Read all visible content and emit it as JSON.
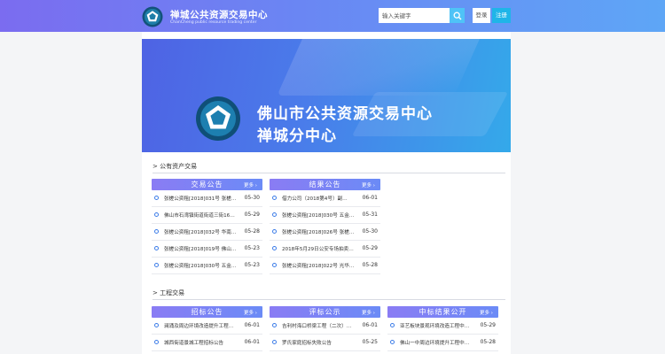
{
  "header": {
    "brand_cn": "禅城公共资源交易中心",
    "brand_en": "ChanCheng public resource trading center",
    "search_placeholder": "输入关键字",
    "login": "登录",
    "register": "注册"
  },
  "banner": {
    "line1": "佛山市公共资源交易中心",
    "line2": "禅城分中心"
  },
  "sections": [
    {
      "title": "> 公有资产交易",
      "panels": [
        {
          "title": "交易公告",
          "more": "更多 ›",
          "items": [
            {
              "text": "张槎公资租[2018]031号 张槎…",
              "date": "05-30"
            },
            {
              "text": "佛山市石湾镇街道街道三街16…",
              "date": "05-29"
            },
            {
              "text": "张槎公资租[2018]032号 华南…",
              "date": "05-28"
            },
            {
              "text": "张槎公资租[2018]019号 佛山…",
              "date": "05-23"
            },
            {
              "text": "张槎公资租[2018]030号 五金…",
              "date": "05-23"
            }
          ]
        },
        {
          "title": "结果公告",
          "more": "更多 ›",
          "items": [
            {
              "text": "借力公司（2018第4号）副…",
              "date": "06-01"
            },
            {
              "text": "张槎公资租[2018]030号 五金…",
              "date": "05-31"
            },
            {
              "text": "张槎公资租[2018]026号 张槎…",
              "date": "05-30"
            },
            {
              "text": "2018年5月29日公安专场拍卖…",
              "date": "05-29"
            },
            {
              "text": "张槎公资租[2018]022号 光华…",
              "date": "05-28"
            }
          ]
        }
      ]
    },
    {
      "title": "> 工程交易",
      "panels": [
        {
          "title": "招标公告",
          "more": "更多 ›",
          "items": [
            {
              "text": "澜涌及周边环境改造提升工程…",
              "date": "06-01"
            },
            {
              "text": "城西街道景城工程招标公告",
              "date": "06-01"
            }
          ]
        },
        {
          "title": "评标公示",
          "more": "更多 ›",
          "items": [
            {
              "text": "吉利村海口桥梁工程（二次）…",
              "date": "06-01"
            },
            {
              "text": "罗氏家庭招标失败公告",
              "date": "05-25"
            }
          ]
        },
        {
          "title": "中标结果公开",
          "more": "更多 ›",
          "items": [
            {
              "text": "亚艺板块景观环境改造工程中…",
              "date": "05-29"
            },
            {
              "text": "佛山一中周边环境提升工程中…",
              "date": "05-28"
            }
          ]
        }
      ]
    }
  ]
}
